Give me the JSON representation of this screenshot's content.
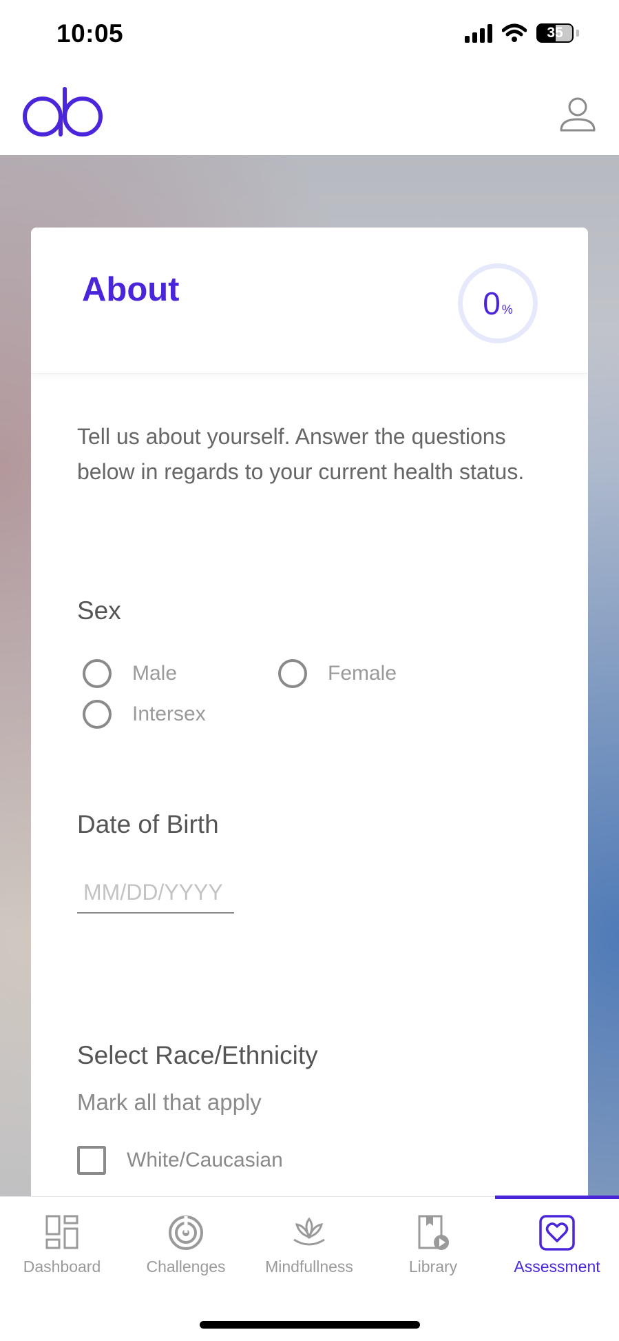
{
  "status_bar": {
    "time": "10:05",
    "battery": "35",
    "icons": [
      "signal-icon",
      "wifi-icon",
      "battery-icon"
    ]
  },
  "header": {
    "logo": "ab",
    "icons": [
      "logo-icon",
      "profile-icon"
    ]
  },
  "card": {
    "title": "About",
    "progress_value": "0",
    "progress_unit": "%",
    "intro": "Tell us about yourself. Answer the questions below in regards to your current health status."
  },
  "sex": {
    "label": "Sex",
    "options": [
      "Male",
      "Female",
      "Intersex"
    ]
  },
  "dob": {
    "label": "Date of Birth",
    "placeholder": "MM/DD/YYYY",
    "value": ""
  },
  "race": {
    "label": "Select Race/Ethnicity",
    "hint": "Mark all that apply",
    "options": [
      "White/Caucasian"
    ]
  },
  "nav": {
    "items": [
      {
        "label": "Dashboard",
        "icon": "dashboard-icon"
      },
      {
        "label": "Challenges",
        "icon": "challenges-icon"
      },
      {
        "label": "Mindfullness",
        "icon": "lotus-icon"
      },
      {
        "label": "Library",
        "icon": "library-icon"
      },
      {
        "label": "Assessment",
        "icon": "heart-icon"
      }
    ],
    "active": "Assessment"
  },
  "colors": {
    "accent": "#4a25d9",
    "ring": "#e6e9fb",
    "text": "#555555",
    "muted": "#9a9a9a"
  }
}
